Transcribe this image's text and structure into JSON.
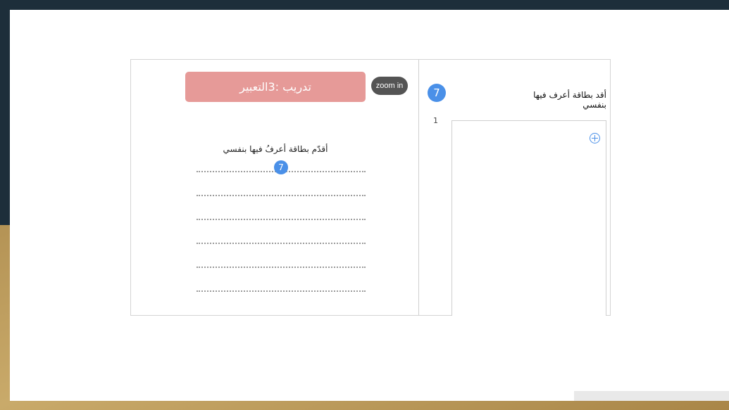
{
  "worksheet": {
    "banner_label": "تدريب :3التعبير",
    "zoom_label": "zoom in",
    "title": "أقدّم بطاقة أعرفُ فيها بنفسي",
    "badge": "7",
    "line_count": 6
  },
  "task": {
    "title": "أقد بطاقة أعرف فيها بنفسي",
    "badge": "7",
    "page_number": "1"
  },
  "colors": {
    "banner": "#e69a98",
    "accent": "#4a90e8",
    "zoom": "#545454",
    "frame": "#1d2e3a",
    "gold": "#b49355"
  },
  "icons": {
    "add": "plus-circle-icon"
  }
}
